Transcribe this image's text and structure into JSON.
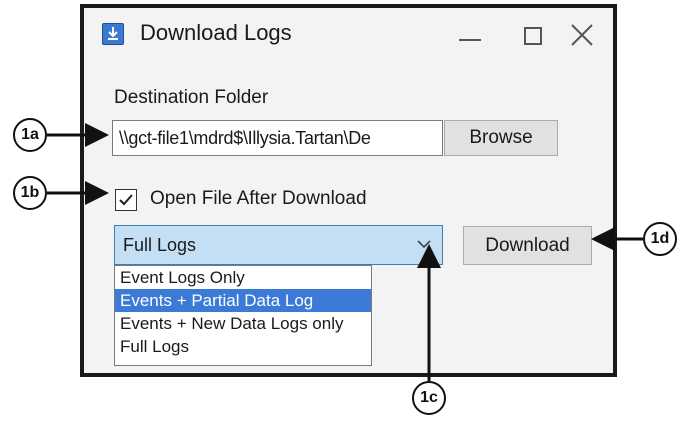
{
  "window": {
    "title": "Download Logs",
    "destination_label": "Destination Folder",
    "destination_path": "\\\\gct-file1\\mdrd$\\Illysia.Tartan\\De",
    "browse_label": "Browse",
    "open_after_label": "Open File After Download",
    "open_after_checked": true,
    "log_type_selected": "Full Logs",
    "download_label": "Download",
    "log_type_options": [
      "Event Logs Only",
      "Events + Partial Data Log",
      "Events + New Data Logs only",
      "Full Logs"
    ],
    "highlighted_option_index": 1
  },
  "callouts": {
    "c1a": "1a",
    "c1b": "1b",
    "c1c": "1c",
    "c1d": "1d"
  },
  "icons": {
    "app": "download-app-icon",
    "minimize": "minimize-icon",
    "maximize": "maximize-icon",
    "close": "close-icon",
    "checkbox": "checkmark-icon",
    "dropdown": "chevron-down-icon"
  },
  "colors": {
    "combo_highlight": "#c4def3",
    "selection": "#3b7ad6",
    "window_bg": "#f3f3f3"
  }
}
